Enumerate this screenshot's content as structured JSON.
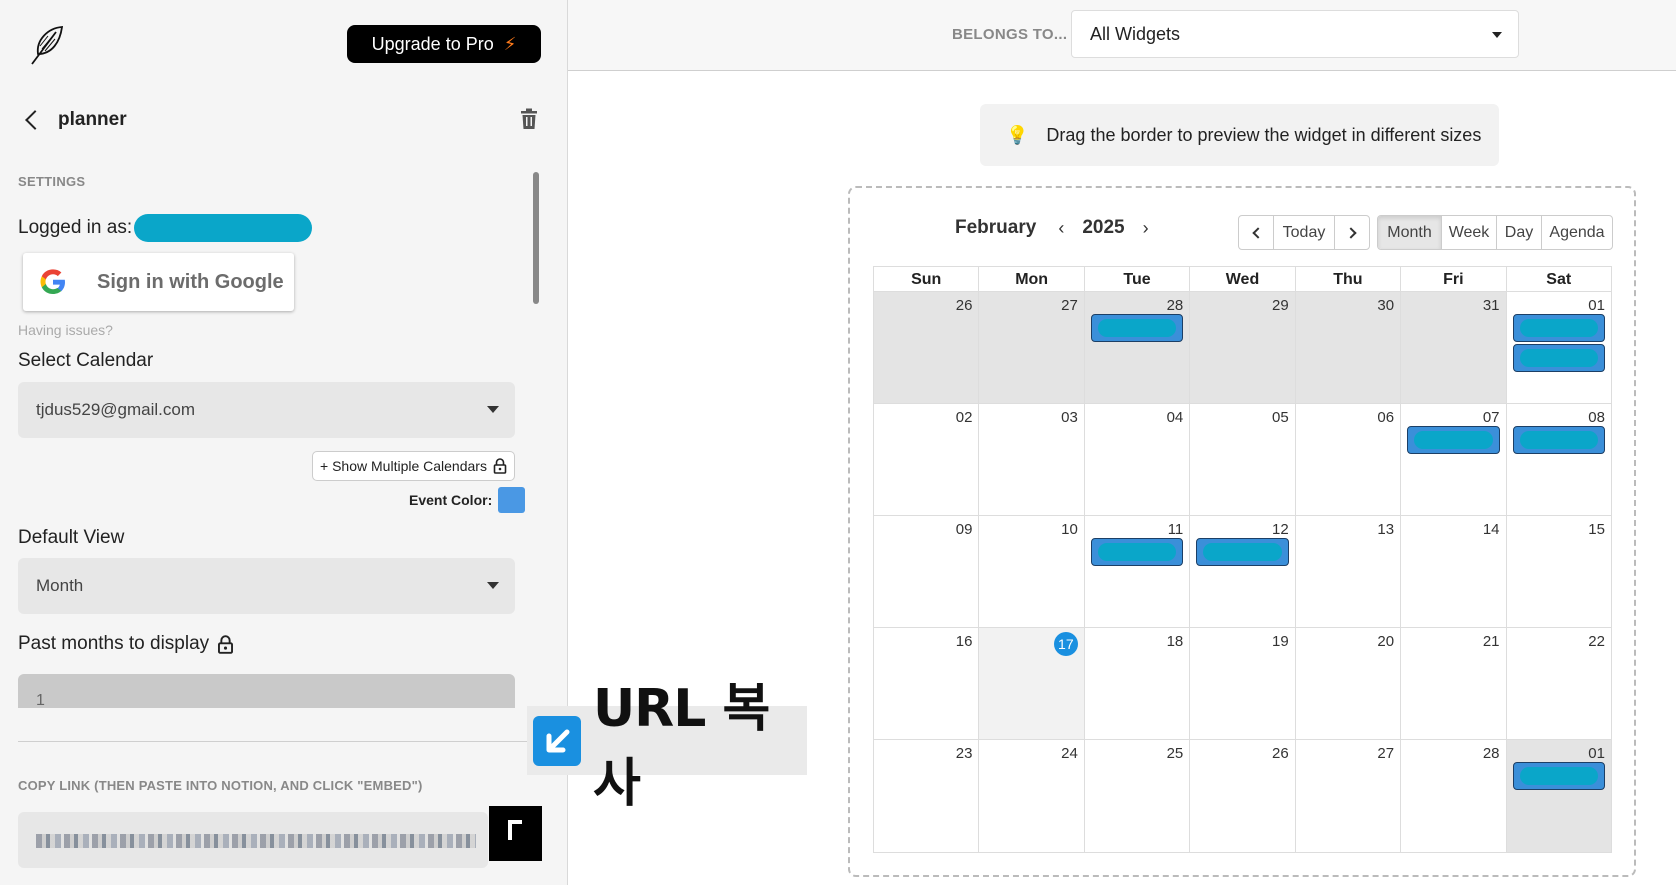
{
  "sidebar": {
    "upgrade_label": "Upgrade to Pro",
    "page_title": "planner",
    "settings_label": "SETTINGS",
    "logged_in_label": "Logged in as:",
    "google_signin_label": "Sign in with Google",
    "having_issues": "Having issues?",
    "select_calendar_label": "Select Calendar",
    "calendar_value": "tjdus529@gmail.com",
    "show_multiple_label": "+ Show Multiple Calendars",
    "event_color_label": "Event Color:",
    "event_color": "#4a98e4",
    "default_view_label": "Default View",
    "default_view_value": "Month",
    "past_months_label": "Past months to display",
    "past_months_value": "1",
    "copy_link_label": "COPY LINK (THEN PASTE INTO NOTION, AND CLICK \"EMBED\")"
  },
  "overlay": {
    "url_copy_text": "URL 복사"
  },
  "topbar": {
    "belongs_label": "BELONGS TO...",
    "widget_select_value": "All Widgets"
  },
  "tip": {
    "text": "Drag the border to preview the widget in different sizes"
  },
  "calendar": {
    "month": "February",
    "year": "2025",
    "today_label": "Today",
    "views": [
      "Month",
      "Week",
      "Day",
      "Agenda"
    ],
    "active_view": "Month",
    "weekdays": [
      "Sun",
      "Mon",
      "Tue",
      "Wed",
      "Thu",
      "Fri",
      "Sat"
    ],
    "weeks": [
      [
        {
          "d": "26",
          "off": true,
          "events": 0
        },
        {
          "d": "27",
          "off": true,
          "events": 0
        },
        {
          "d": "28",
          "off": true,
          "events": 1
        },
        {
          "d": "29",
          "off": true,
          "events": 0
        },
        {
          "d": "30",
          "off": true,
          "events": 0
        },
        {
          "d": "31",
          "off": true,
          "events": 0
        },
        {
          "d": "01",
          "off": false,
          "events": 2
        }
      ],
      [
        {
          "d": "02",
          "off": false,
          "events": 0
        },
        {
          "d": "03",
          "off": false,
          "events": 0
        },
        {
          "d": "04",
          "off": false,
          "events": 0
        },
        {
          "d": "05",
          "off": false,
          "events": 0
        },
        {
          "d": "06",
          "off": false,
          "events": 0
        },
        {
          "d": "07",
          "off": false,
          "events": 1
        },
        {
          "d": "08",
          "off": false,
          "events": 1
        }
      ],
      [
        {
          "d": "09",
          "off": false,
          "events": 0
        },
        {
          "d": "10",
          "off": false,
          "events": 0
        },
        {
          "d": "11",
          "off": false,
          "events": 1
        },
        {
          "d": "12",
          "off": false,
          "events": 1
        },
        {
          "d": "13",
          "off": false,
          "events": 0
        },
        {
          "d": "14",
          "off": false,
          "events": 0
        },
        {
          "d": "15",
          "off": false,
          "events": 0
        }
      ],
      [
        {
          "d": "16",
          "off": false,
          "events": 0
        },
        {
          "d": "17",
          "off": false,
          "events": 0,
          "today": true
        },
        {
          "d": "18",
          "off": false,
          "events": 0
        },
        {
          "d": "19",
          "off": false,
          "events": 0
        },
        {
          "d": "20",
          "off": false,
          "events": 0
        },
        {
          "d": "21",
          "off": false,
          "events": 0
        },
        {
          "d": "22",
          "off": false,
          "events": 0
        }
      ],
      [
        {
          "d": "23",
          "off": false,
          "events": 0
        },
        {
          "d": "24",
          "off": false,
          "events": 0
        },
        {
          "d": "25",
          "off": false,
          "events": 0
        },
        {
          "d": "26",
          "off": false,
          "events": 0
        },
        {
          "d": "27",
          "off": false,
          "events": 0
        },
        {
          "d": "28",
          "off": false,
          "events": 0
        },
        {
          "d": "01",
          "off": true,
          "events": 1
        }
      ]
    ]
  }
}
